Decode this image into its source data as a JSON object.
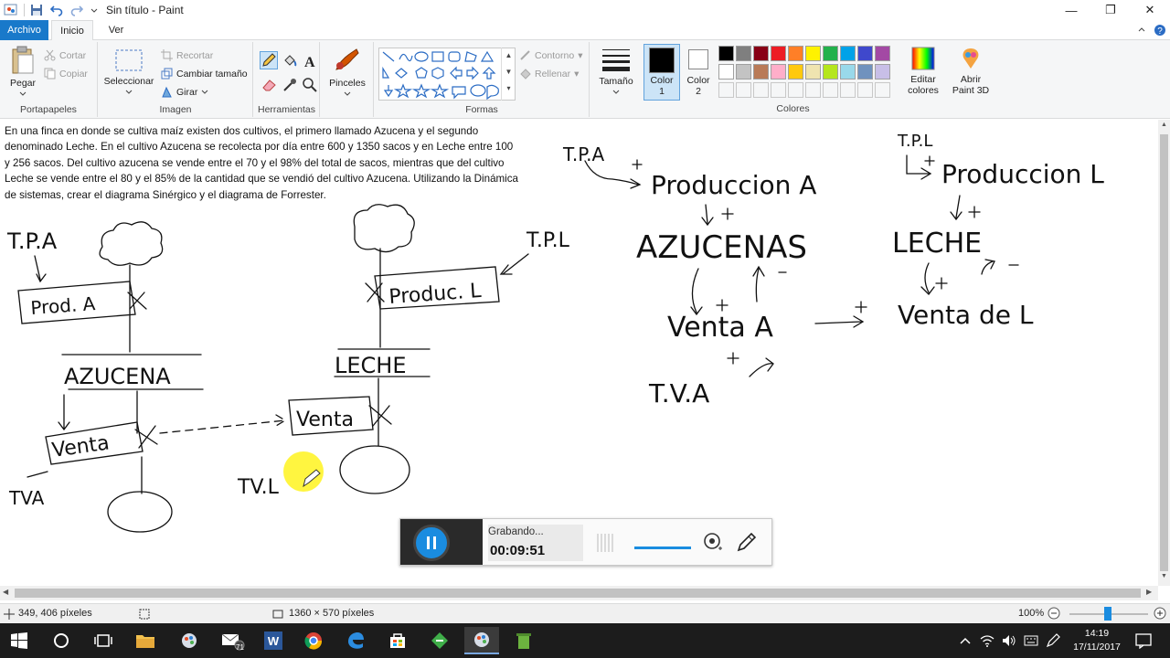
{
  "window": {
    "title": "Sin título - Paint",
    "minimize_glyph": "—",
    "restore_glyph": "❐",
    "close_glyph": "✕"
  },
  "tabs": [
    {
      "label": "Archivo",
      "active": true
    },
    {
      "label": "Inicio",
      "active": false
    },
    {
      "label": "Ver",
      "active": false
    }
  ],
  "ribbon": {
    "clipboard": {
      "paste": "Pegar",
      "cut": "Cortar",
      "copy": "Copiar",
      "group": "Portapapeles"
    },
    "image": {
      "select": "Seleccionar",
      "crop": "Recortar",
      "resize": "Cambiar tamaño",
      "rotate": "Girar",
      "group": "Imagen"
    },
    "tools": {
      "group": "Herramientas"
    },
    "brushes": {
      "label": "Pinceles"
    },
    "shapes": {
      "outline": "Contorno",
      "fill": "Rellenar",
      "group": "Formas"
    },
    "size": {
      "label": "Tamaño"
    },
    "color1": {
      "label": "Color",
      "num": "1"
    },
    "color2": {
      "label": "Color",
      "num": "2"
    },
    "colors": {
      "group": "Colores",
      "edit": "Editar",
      "edit2": "colores"
    },
    "paint3d": {
      "label": "Abrir",
      "label2": "Paint 3D"
    }
  },
  "palette_row1": [
    "#000000",
    "#7f7f7f",
    "#880015",
    "#ed1c24",
    "#ff7f27",
    "#fff200",
    "#22b14c",
    "#00a2e8",
    "#3f48cc",
    "#a349a4"
  ],
  "palette_row2": [
    "#ffffff",
    "#c3c3c3",
    "#b97a57",
    "#ffaec9",
    "#ffc90e",
    "#efe4b0",
    "#b5e61d",
    "#99d9ea",
    "#7092be",
    "#c8bfe7"
  ],
  "problem_text": "En una finca en donde se cultiva maíz existen dos cultivos, el primero llamado Azucena y el segundo denominado Leche. En el cultivo Azucena se recolecta por día entre 600 y 1350 sacos y en Leche entre 100 y 256 sacos. Del cultivo azucena se vende entre el 70 y el 98% del total de sacos, mientras que del cultivo Leche se vende entre el 80 y el 85% de la cantidad que se vendió del cultivo Azucena. Utilizando la Dinámica de sistemas, crear el diagrama Sinérgico y el diagrama de Forrester.",
  "drawing": {
    "tpa_left": "T.P.A",
    "prod_a": "Prod. A",
    "azucena": "AZUCENA",
    "venta_left": "Venta",
    "tva": "TVA",
    "tpl": "T.P.L",
    "produc_l": "Produc. L",
    "leche_left": "LECHE",
    "venta_mid": "Venta",
    "tvl": "TV.L",
    "tpa_right": "T.P.A",
    "produccion_a": "Produccion A",
    "azucenas": "AZUCENAS",
    "venta_a": "Venta A",
    "tva_right": "T.V.A",
    "tpl_right": "T.P.L",
    "produccion_l": "Produccion L",
    "leche_right": "LECHE",
    "venta_l": "Venta de L"
  },
  "recorder": {
    "status": "Grabando...",
    "time": "00:09:51"
  },
  "status": {
    "cursor": "349, 406 píxeles",
    "size": "1360 × 570 píxeles",
    "zoom": "100%"
  },
  "clock": {
    "time": "14:19",
    "date": "17/11/2017"
  },
  "taskbar_badge": "71"
}
